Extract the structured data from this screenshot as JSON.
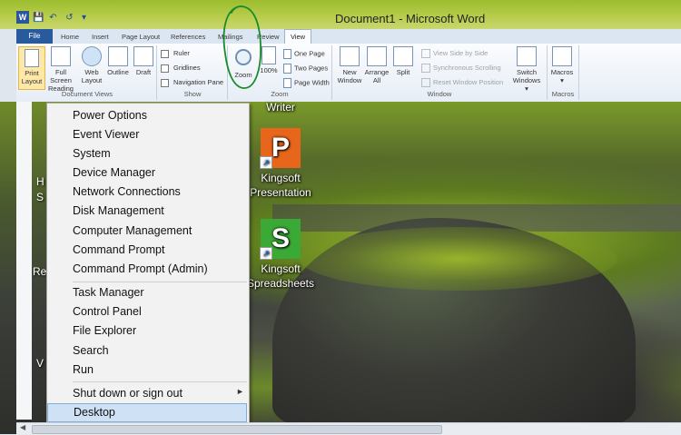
{
  "window": {
    "title": "Document1 - Microsoft Word",
    "app_icon": "W"
  },
  "quick_access": {
    "save": "save-icon",
    "undo": "undo-icon",
    "redo": "redo-icon",
    "customize": "dropdown-icon"
  },
  "tabs": [
    "File",
    "Home",
    "Insert",
    "Page Layout",
    "References",
    "Mailings",
    "Review",
    "View"
  ],
  "active_tab": "View",
  "ribbon": {
    "document_views": {
      "group_label": "Document Views",
      "buttons": [
        {
          "l1": "Print",
          "l2": "Layout"
        },
        {
          "l1": "Full Screen",
          "l2": "Reading"
        },
        {
          "l1": "Web",
          "l2": "Layout"
        },
        {
          "l1": "Outline",
          "l2": ""
        },
        {
          "l1": "Draft",
          "l2": ""
        }
      ]
    },
    "show": {
      "group_label": "Show",
      "items": [
        "Ruler",
        "Gridlines",
        "Navigation Pane"
      ]
    },
    "zoom": {
      "group_label": "Zoom",
      "zoom_label": "Zoom",
      "percent_label": "100%",
      "items": [
        "One Page",
        "Two Pages",
        "Page Width"
      ]
    },
    "window": {
      "group_label": "Window",
      "buttons": [
        {
          "l1": "New",
          "l2": "Window"
        },
        {
          "l1": "Arrange",
          "l2": "All"
        },
        {
          "l1": "Split",
          "l2": ""
        }
      ],
      "disabled_items": [
        "View Side by Side",
        "Synchronous Scrolling",
        "Reset Window Position"
      ],
      "switch": {
        "l1": "Switch",
        "l2": "Windows ▾"
      }
    },
    "macros": {
      "group_label": "Macros",
      "button": {
        "l1": "Macros",
        "l2": "▾"
      }
    }
  },
  "context_menu": {
    "group1": [
      "Power Options",
      "Event Viewer",
      "System",
      "Device Manager",
      "Network Connections",
      "Disk Management",
      "Computer Management",
      "Command Prompt",
      "Command Prompt (Admin)"
    ],
    "group2": [
      "Task Manager",
      "Control Panel",
      "File Explorer",
      "Search",
      "Run"
    ],
    "group3": [
      "Shut down or sign out",
      "Desktop"
    ],
    "submenu_arrow": "►"
  },
  "desktop_icons": [
    {
      "label1": "Writer",
      "label2": ""
    },
    {
      "label1": "Kingsoft",
      "label2": "Presentation",
      "glyph": "P",
      "color": "#e8661c"
    },
    {
      "label1": "Kingsoft",
      "label2": "Spreadsheets",
      "glyph": "S",
      "color": "#3aa935"
    }
  ],
  "left_fragments": [
    "H",
    "S",
    "Re",
    "V"
  ]
}
